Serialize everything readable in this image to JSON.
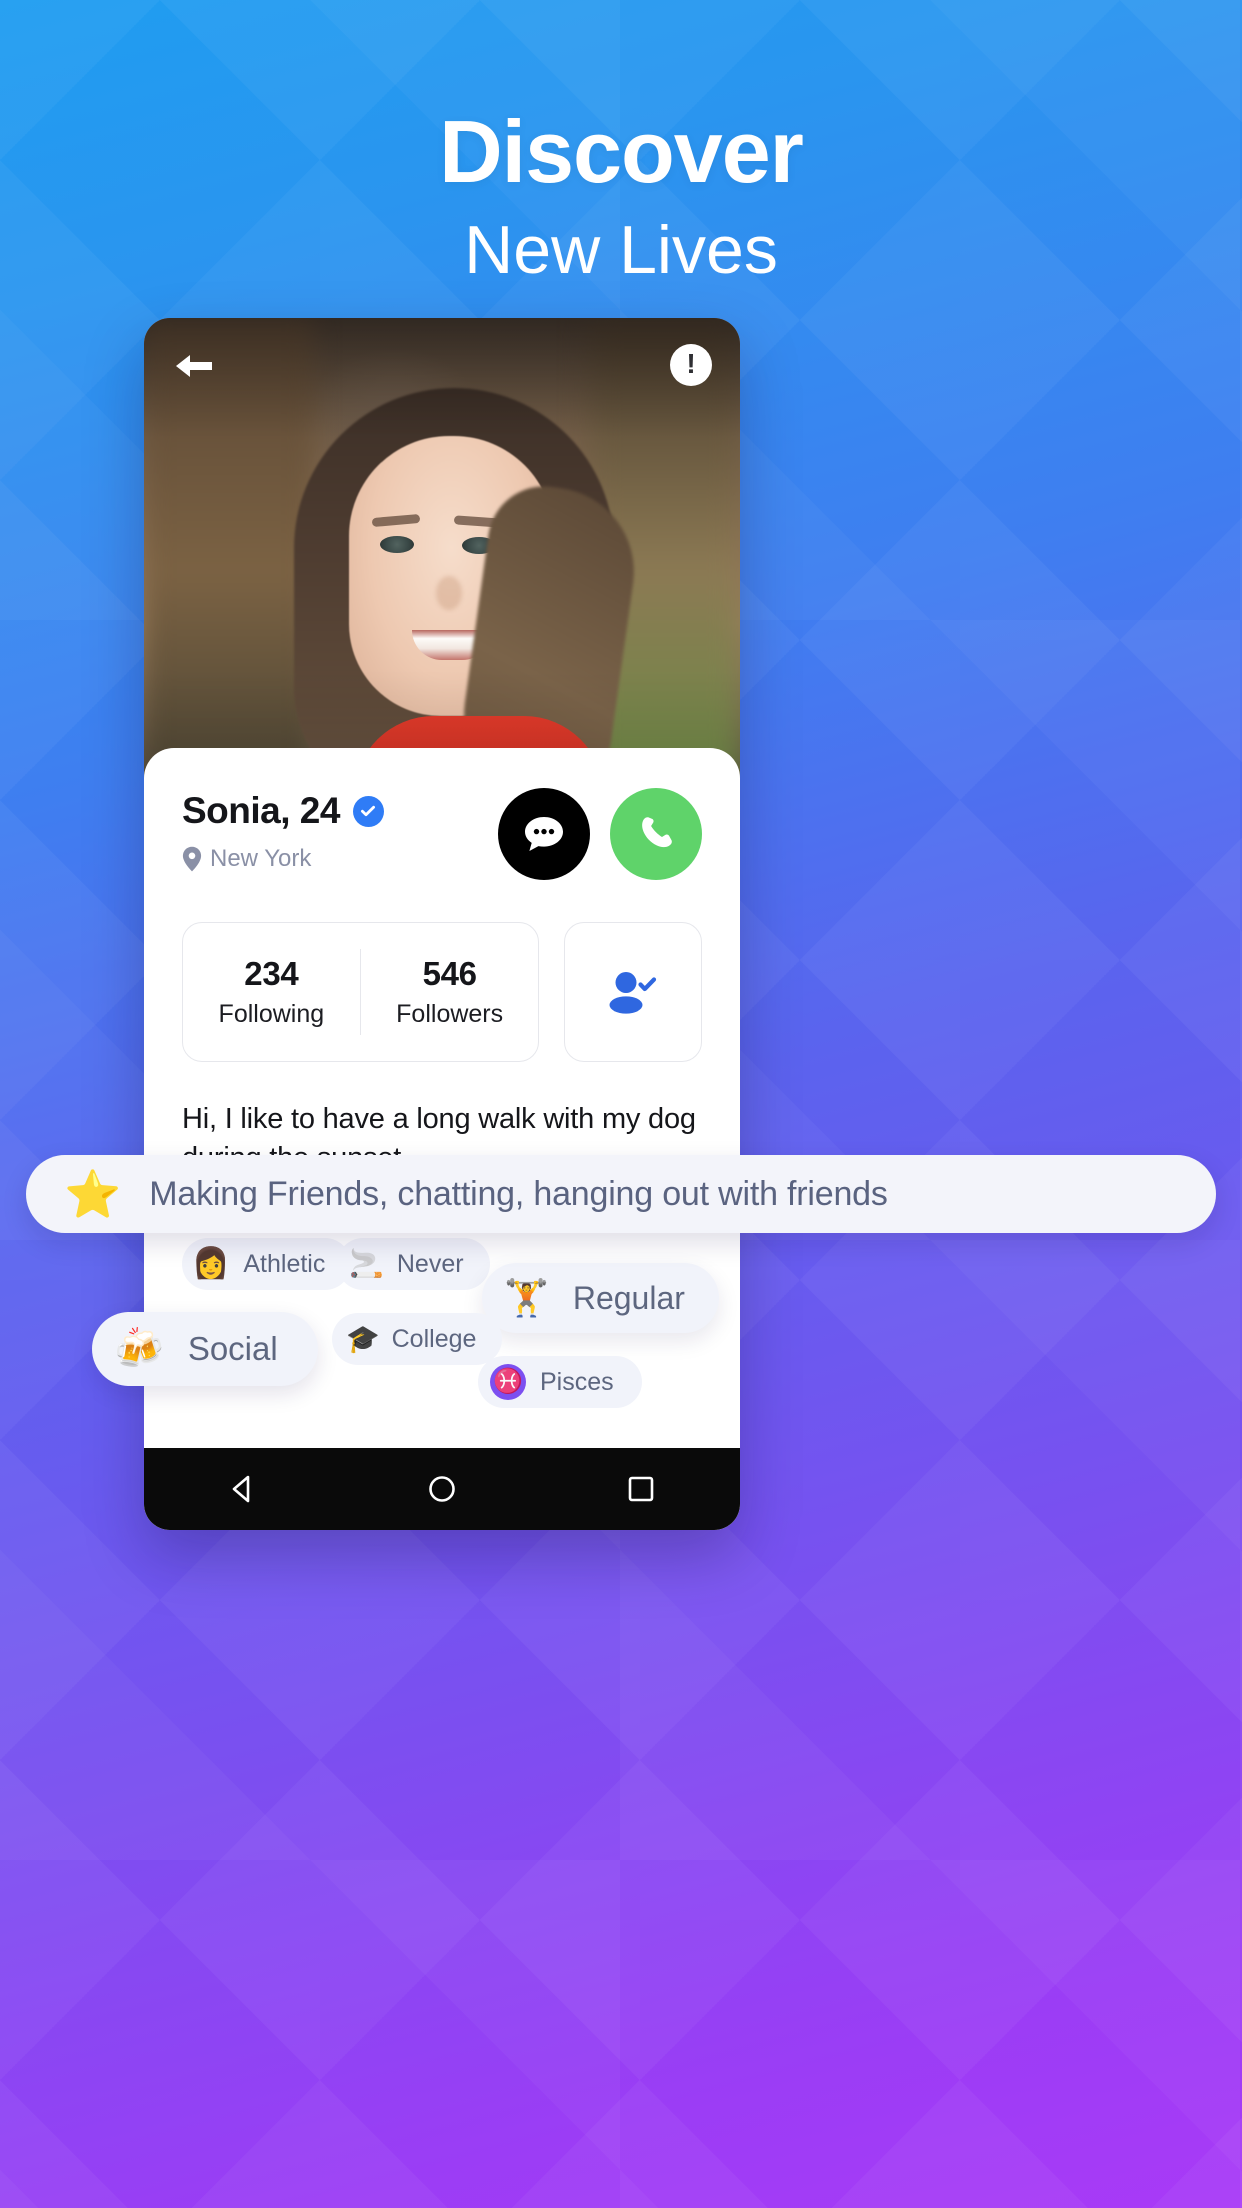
{
  "hero": {
    "headline": "Discover",
    "subhead": "New Lives"
  },
  "colors": {
    "brand_blue": "#2f7cf6",
    "call_green": "#5fd36a",
    "chat_black": "#000000",
    "chip_bg": "#f1f3fa",
    "chip_text": "#5d667f",
    "zodiac_purple": "#7c4ff0",
    "star_gold": "#ffb429",
    "bg_top": "#1f9df0",
    "bg_bottom": "#a93af7"
  },
  "phone": {
    "topbar": {
      "back_icon": "arrow-left-icon",
      "report_icon": "exclamation-icon",
      "report_label": "!"
    },
    "gallery": {
      "dot_count": 5,
      "active_index": 0
    },
    "profile": {
      "name": "Sonia, 24",
      "verified_icon": "verified-check-icon",
      "location_icon": "location-pin-icon",
      "location": "New York",
      "chat_icon": "chat-bubble-icon",
      "call_icon": "phone-icon",
      "add_friend_icon": "person-check-icon"
    },
    "stats": [
      {
        "value": "234",
        "label": "Following"
      },
      {
        "value": "546",
        "label": "Followers"
      }
    ],
    "bio": "Hi, I like to have a long walk with my dog during the sunset.",
    "looking_for": {
      "icon": "star-icon",
      "emoji": "⭐",
      "text": "Making Friends, chatting, hanging out with friends"
    },
    "tags": [
      {
        "key": "athletic",
        "emoji": "👩",
        "icon": "person-icon",
        "label": "Athletic"
      },
      {
        "key": "never",
        "emoji": "🚬",
        "icon": "cigarette-icon",
        "label": "Never"
      },
      {
        "key": "regular",
        "emoji": "🏋",
        "icon": "dumbbell-icon",
        "label": "Regular"
      },
      {
        "key": "social",
        "emoji": "🍻",
        "icon": "beer-mugs-icon",
        "label": "Social"
      },
      {
        "key": "college",
        "emoji": "🎓",
        "icon": "graduation-cap-icon",
        "label": "College"
      },
      {
        "key": "pisces",
        "emoji": "♓",
        "icon": "pisces-icon",
        "label": "Pisces"
      }
    ],
    "navbar": {
      "back_icon": "triangle-back-icon",
      "home_icon": "circle-home-icon",
      "recents_icon": "square-recents-icon"
    }
  }
}
